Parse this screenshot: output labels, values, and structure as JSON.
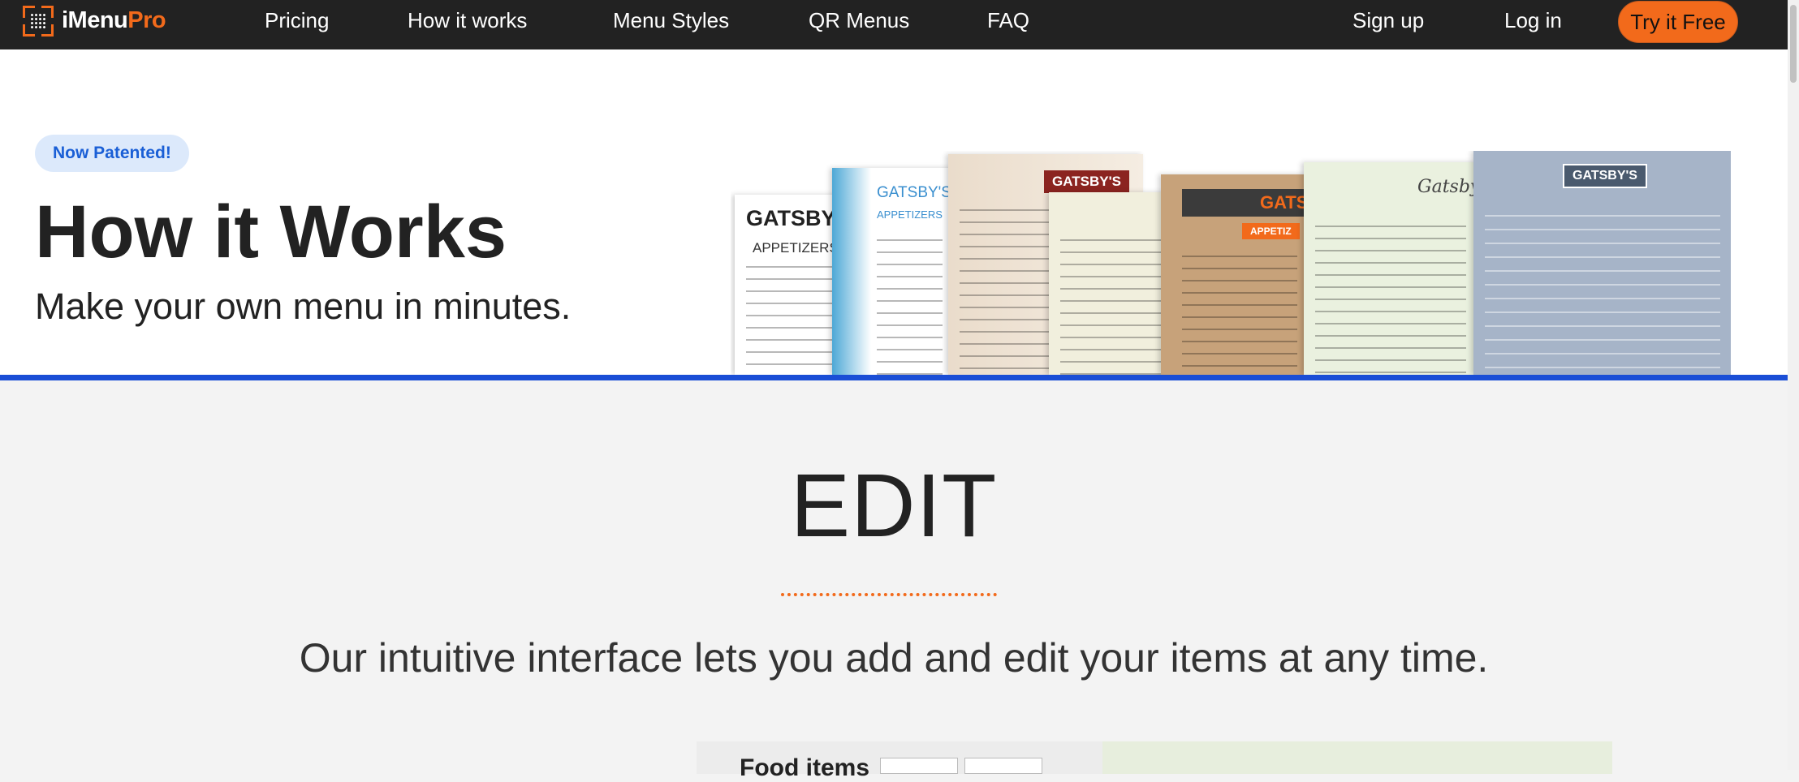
{
  "nav": {
    "logo_main": "iMenu",
    "logo_accent": "Pro",
    "links": [
      "Pricing",
      "How it works",
      "Menu Styles",
      "QR Menus",
      "FAQ"
    ],
    "active": "How it works",
    "signup": "Sign up",
    "login": "Log in",
    "try_free": "Try it Free"
  },
  "hero": {
    "badge": "Now Patented!",
    "title": "How it Works",
    "subtitle": "Make your own menu in minutes.",
    "menus": {
      "m1_title": "GATSBY'S",
      "m1_sub": "APPETIZERS",
      "m2_title": "GATSBY'S",
      "m2_sub": "APPETIZERS",
      "m3_tag": "GATSBY'S",
      "m5_title": "GATSB",
      "m5_pill": "APPETIZ",
      "m6_title": "Gatsby's",
      "m7_title": "GATSBY'S"
    }
  },
  "edit": {
    "title": "EDIT",
    "description": "Our intuitive interface lets you add and edit your items at any time.",
    "preview_label": "Food items"
  },
  "colors": {
    "nav_bg": "#222222",
    "accent": "#f26a1b",
    "hero_bar": "#1a4ed6",
    "badge_bg": "#dce9fb",
    "badge_text": "#1a5fd6"
  }
}
